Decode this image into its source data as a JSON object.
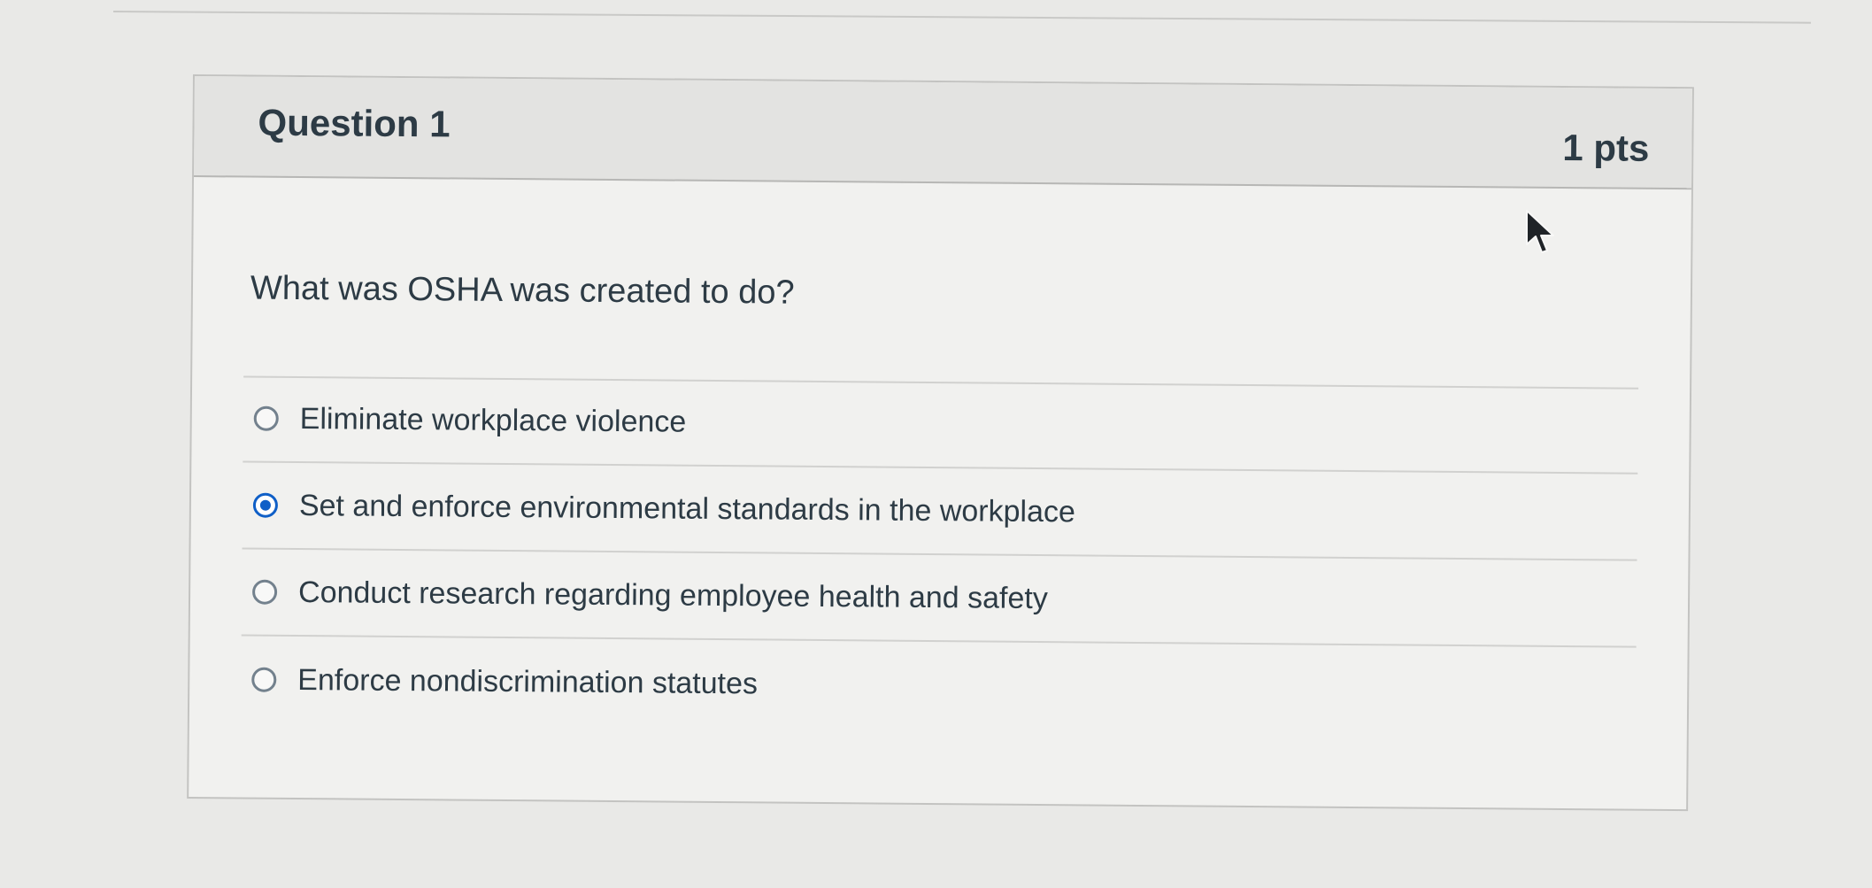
{
  "question": {
    "title": "Question 1",
    "points": "1 pts",
    "prompt": "What was OSHA was created to do?"
  },
  "answers": [
    {
      "label": "Eliminate workplace violence",
      "selected": false
    },
    {
      "label": "Set and enforce environmental standards in the workplace",
      "selected": true
    },
    {
      "label": "Conduct research regarding employee health and safety",
      "selected": false
    },
    {
      "label": "Enforce nondiscrimination statutes",
      "selected": false
    }
  ],
  "icons": {
    "cursor": "mouse-pointer-icon",
    "radio": "radio-button-icon"
  },
  "colors": {
    "selected": "#0f5fc7",
    "text": "#2d3b45",
    "header_background": "#e3e3e1",
    "card_background": "#f1f1ef",
    "border": "#c3c3c1"
  }
}
